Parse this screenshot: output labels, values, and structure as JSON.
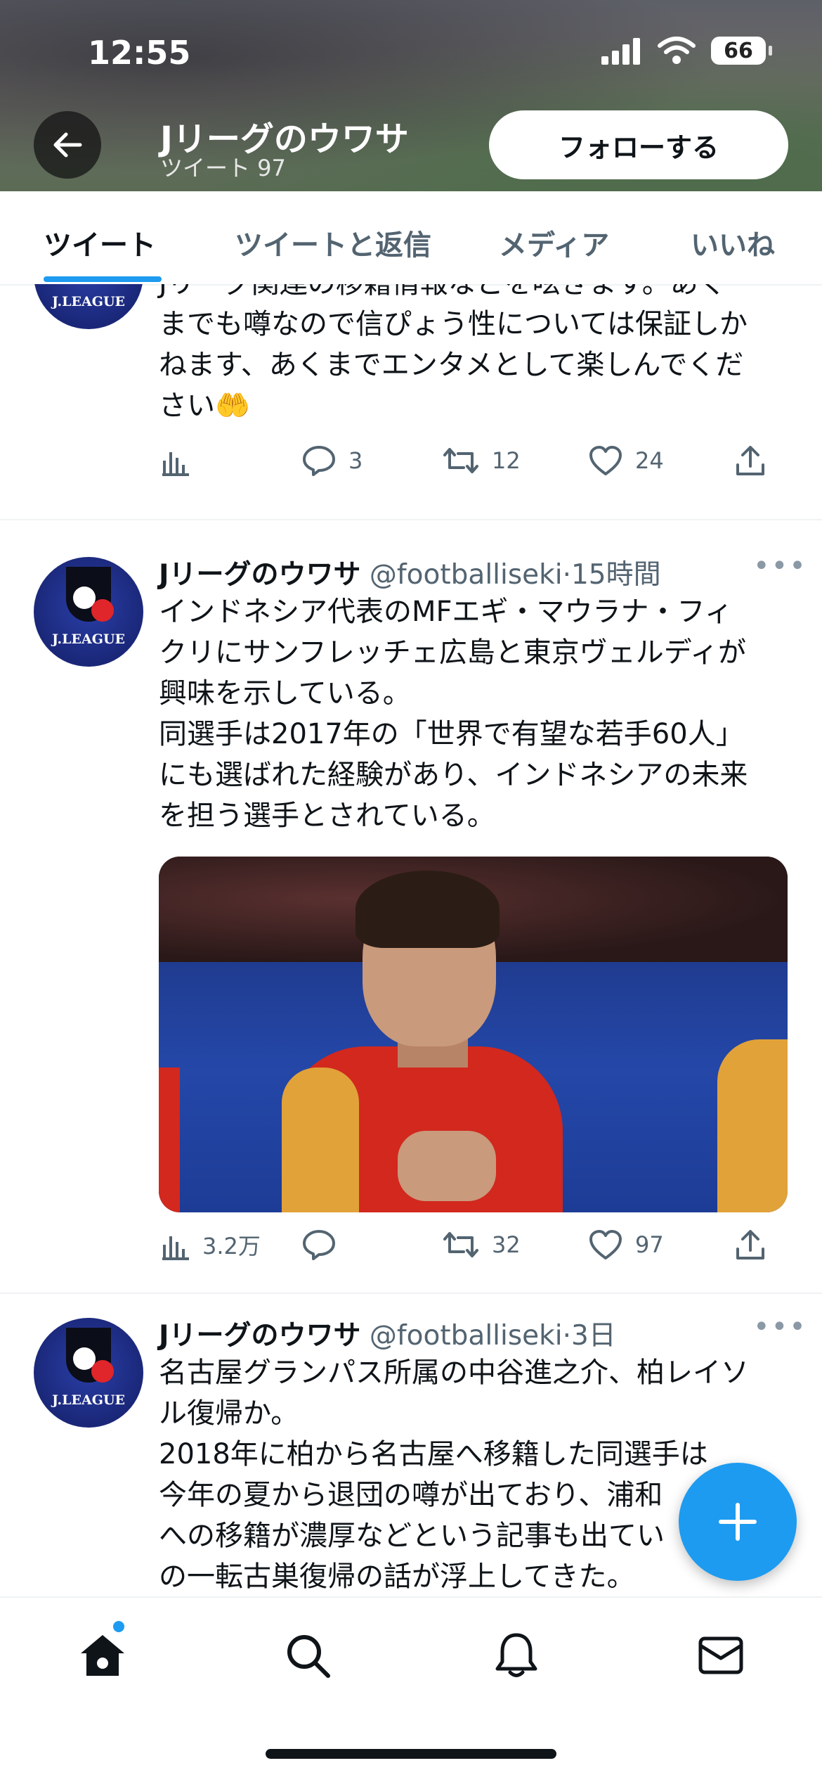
{
  "status_bar": {
    "time": "12:55",
    "battery": "66"
  },
  "profile": {
    "name": "Jリーグのウワサ",
    "tweet_count": "ツイート 97",
    "follow_label": "フォローする"
  },
  "tabs": [
    {
      "label": "ツイート"
    },
    {
      "label": "ツイートと返信"
    },
    {
      "label": "メディア"
    },
    {
      "label": "いいね"
    }
  ],
  "avatar_text": "J.LEAGUE",
  "tweets": [
    {
      "lines": [
        "Jリーグ関連の移籍情報などを呟きます。あく",
        "までも噂なので信ぴょう性については保証しか",
        "ねます、あくまでエンタメとして楽しんでくだ",
        "さい🤲"
      ],
      "views": "",
      "replies": "3",
      "retweets": "12",
      "likes": "24"
    },
    {
      "name": "Jリーグのウワサ",
      "handle": "@footballiseki",
      "time": "15時間",
      "lines": [
        "インドネシア代表のMFエギ・マウラナ・フィ",
        "クリにサンフレッチェ広島と東京ヴェルディが",
        "興味を示している。",
        "同選手は2017年の「世界で有望な若手60人」",
        "にも選ばれた経験があり、インドネシアの未来",
        "を担う選手とされている。"
      ],
      "views": "3.2万",
      "replies": "",
      "retweets": "32",
      "likes": "97"
    },
    {
      "name": "Jリーグのウワサ",
      "handle": "@footballiseki",
      "time": "3日",
      "lines": [
        "名古屋グランパス所属の中谷進之介、柏レイソ",
        "ル復帰か。",
        "2018年に柏から名古屋へ移籍した同選手は",
        "今年の夏から退団の噂が出ており、浦和",
        "への移籍が濃厚などという記事も出てい",
        "の一転古巣復帰の話が浮上してきた。"
      ]
    }
  ],
  "icons": {
    "back": "arrow-left-icon",
    "views": "bar-chart-icon",
    "reply": "speech-bubble-icon",
    "retweet": "retweet-icon",
    "like": "heart-icon",
    "share": "share-icon",
    "compose": "plus-icon",
    "home": "home-icon",
    "search": "search-icon",
    "notifications": "bell-icon",
    "messages": "envelope-icon"
  },
  "colors": {
    "accent": "#1d9bf0",
    "text": "#0f1419",
    "muted": "#536471"
  }
}
